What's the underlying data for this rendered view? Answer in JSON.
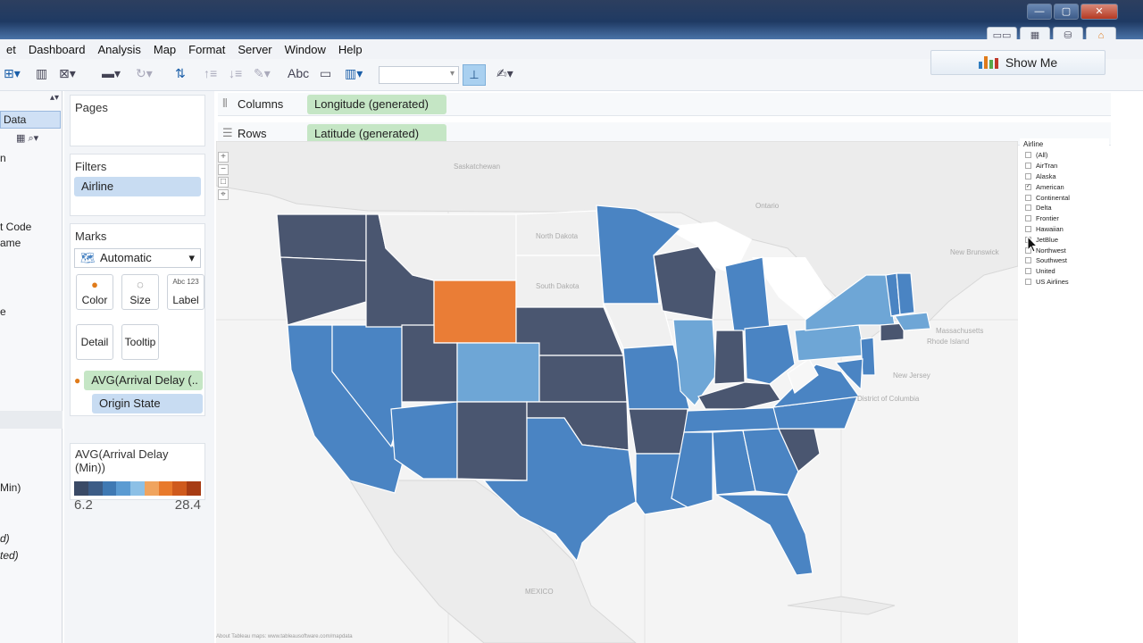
{
  "menu": [
    "et",
    "Dashboard",
    "Analysis",
    "Map",
    "Format",
    "Server",
    "Window",
    "Help"
  ],
  "toolbar": {
    "abc_label": "Abc"
  },
  "show_me": {
    "label": "Show Me"
  },
  "data_pane": {
    "tab": "Data",
    "lines": [
      "n",
      "t Code",
      "ame",
      "e",
      "Min)",
      "d)",
      "ted)"
    ]
  },
  "pages": {
    "title": "Pages"
  },
  "filters": {
    "title": "Filters",
    "pill": "Airline"
  },
  "marks": {
    "title": "Marks",
    "type": "Automatic",
    "buttons": [
      "Color",
      "Size",
      "Label",
      "Detail",
      "Tooltip"
    ],
    "label_icon_text": "Abc 123",
    "pills": [
      "AVG(Arrival Delay (..",
      "Origin State"
    ]
  },
  "legend": {
    "title": "AVG(Arrival Delay (Min))",
    "min": "6.2",
    "max": "28.4",
    "colors": [
      "#3a4a66",
      "#3c5c86",
      "#3f79b3",
      "#5b9bd2",
      "#8cc0e6",
      "#f0a45e",
      "#e87a2c",
      "#cf5a1d",
      "#a73c14"
    ]
  },
  "shelves": {
    "columns": {
      "label": "Columns",
      "pill": "Longitude (generated)"
    },
    "rows": {
      "label": "Rows",
      "pill": "Latitude (generated)"
    }
  },
  "map": {
    "labels": [
      "Saskatchewan",
      "North Dakota",
      "South Dakota",
      "Ontario",
      "New Brunswick",
      "Massachusetts",
      "Rhode Island",
      "New Jersey",
      "District of Columbia",
      "MEXICO"
    ],
    "attribution": "About Tableau maps: www.tableausoftware.com/mapdata",
    "colors": {
      "dark": "#4a5670",
      "mid": "#4a84c3",
      "light": "#6ea6d6",
      "orange": "#ea7d36",
      "none": "#f0f0f0"
    }
  },
  "airline_filter": {
    "title": "Airline",
    "items": [
      {
        "label": "(All)",
        "checked": false
      },
      {
        "label": "AirTran",
        "checked": false
      },
      {
        "label": "Alaska",
        "checked": false
      },
      {
        "label": "American",
        "checked": true
      },
      {
        "label": "Continental",
        "checked": false
      },
      {
        "label": "Delta",
        "checked": false
      },
      {
        "label": "Frontier",
        "checked": false
      },
      {
        "label": "Hawaiian",
        "checked": false
      },
      {
        "label": "JetBlue",
        "checked": false
      },
      {
        "label": "Northwest",
        "checked": false
      },
      {
        "label": "Southwest",
        "checked": false
      },
      {
        "label": "United",
        "checked": false
      },
      {
        "label": "US Airlines",
        "checked": false
      }
    ]
  }
}
